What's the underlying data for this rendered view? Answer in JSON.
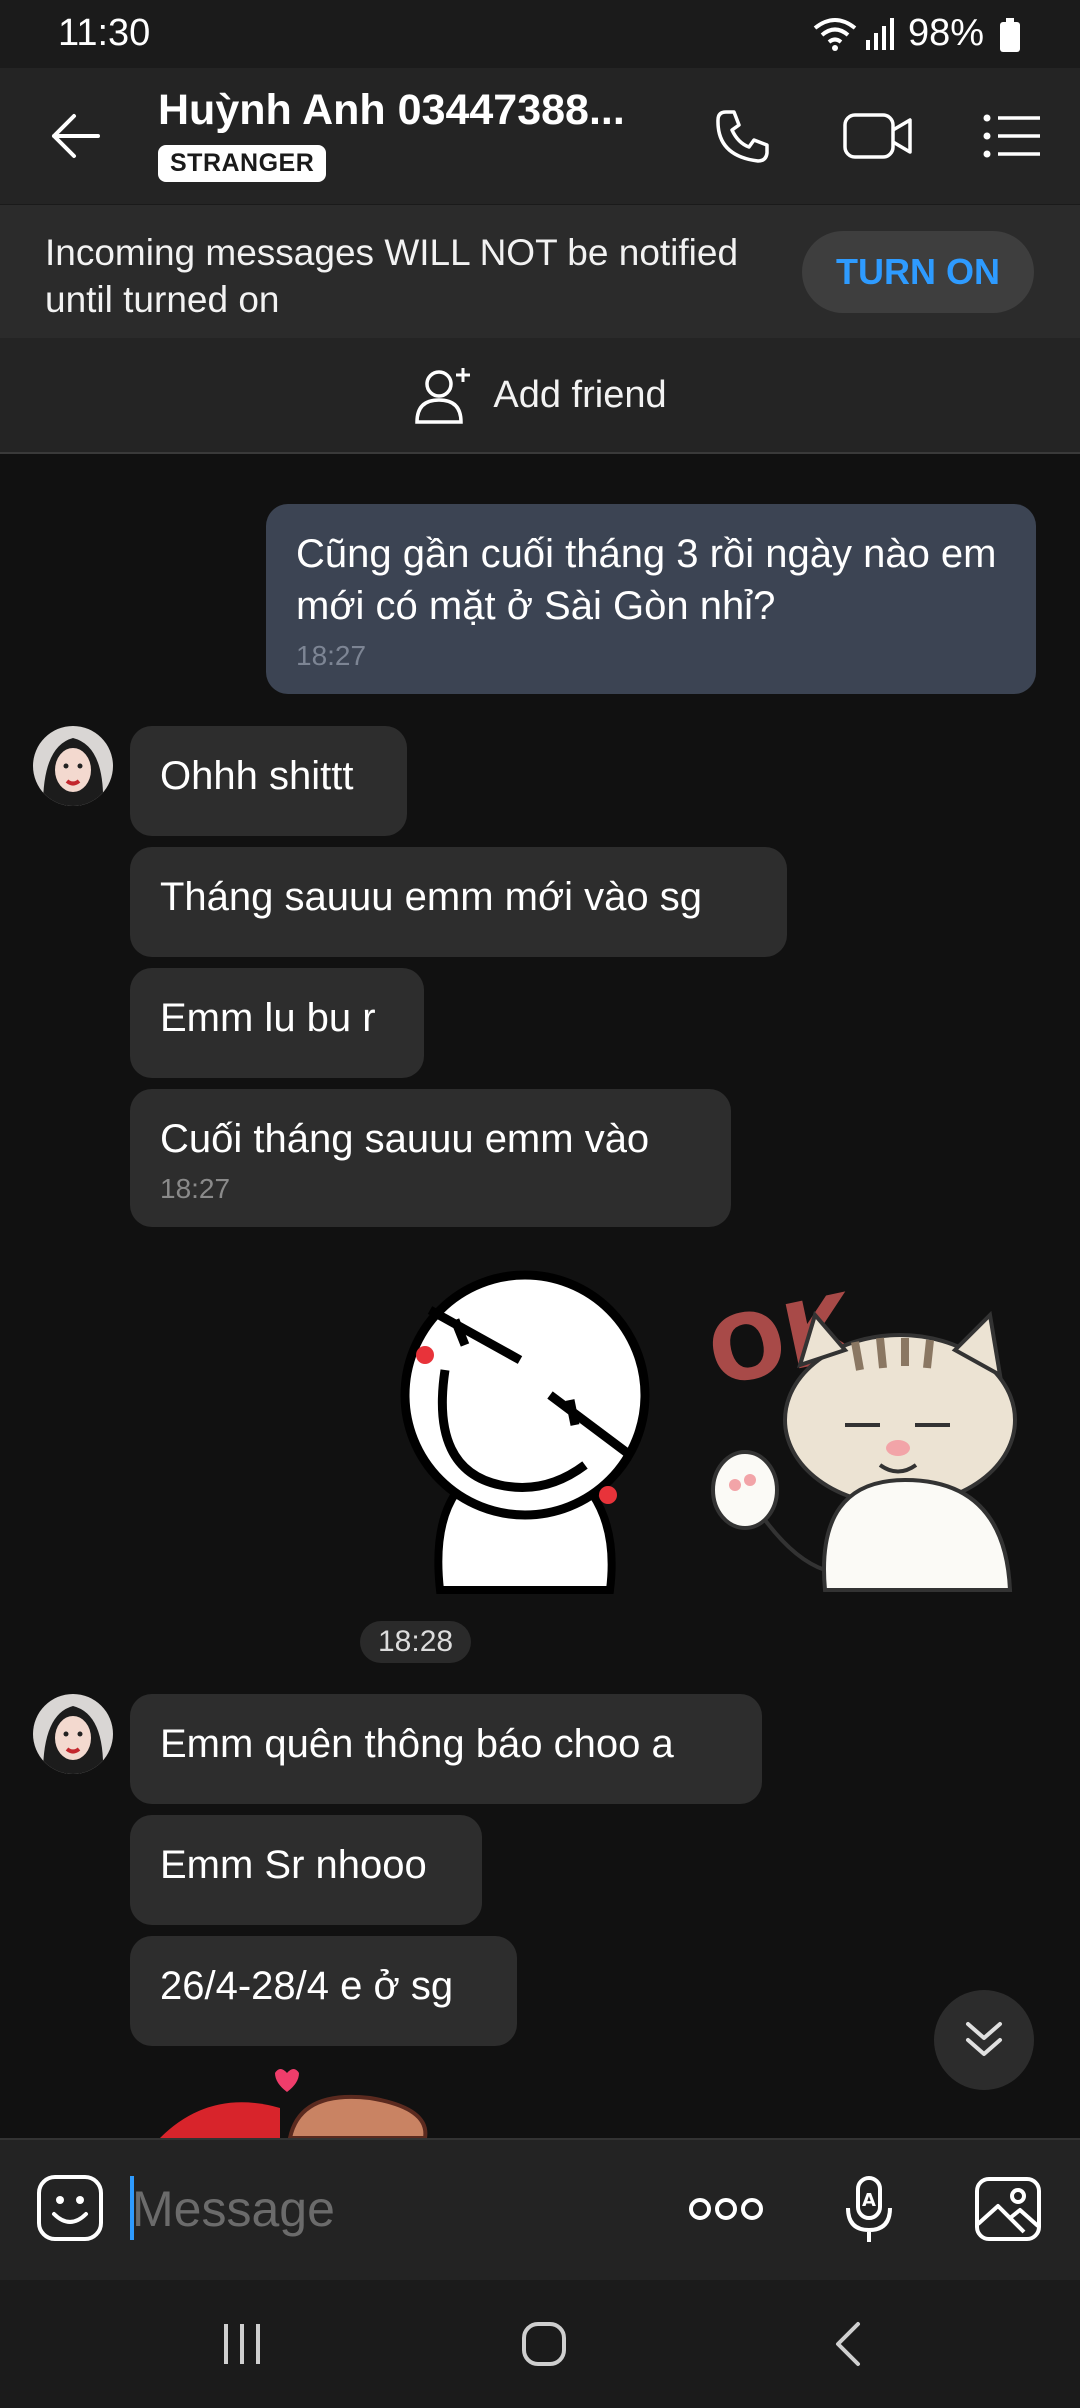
{
  "status_bar": {
    "time": "11:30",
    "battery": "98%"
  },
  "header": {
    "contact_name": "Huỳnh Anh 03447388...",
    "badge": "STRANGER"
  },
  "notice": {
    "text": "Incoming messages WILL NOT be notified until turned on",
    "button": "TURN ON"
  },
  "add_friend": {
    "label": "Add friend"
  },
  "messages": {
    "out1": {
      "text": "Cũng gần cuối tháng 3 rồi ngày nào em mới có mặt ở Sài Gòn nhỉ?",
      "time": "18:27"
    },
    "in1": "Ohhh shittt",
    "in2": "Tháng sauuu emm mới vào sg",
    "in3": "Emm lu bu r",
    "in4": {
      "text": "Cuối tháng sauuu emm vào",
      "time": "18:27"
    },
    "sticker_time": "18:28",
    "in5": "Emm quên thông báo choo a",
    "in6": "Emm Sr nhooo",
    "in7": "26/4-28/4 e ở sg"
  },
  "input": {
    "placeholder": "Message"
  },
  "colors": {
    "accent": "#2e9bff",
    "outgoing_bubble": "#3c4453",
    "incoming_bubble": "#2d2d2d",
    "background": "#111111"
  },
  "icons": [
    "back-arrow-icon",
    "phone-icon",
    "video-icon",
    "menu-icon",
    "add-person-icon",
    "emoji-icon",
    "more-icon",
    "voice-text-icon",
    "image-icon",
    "chevron-double-down-icon",
    "recents-icon",
    "home-icon",
    "nav-back-icon"
  ]
}
